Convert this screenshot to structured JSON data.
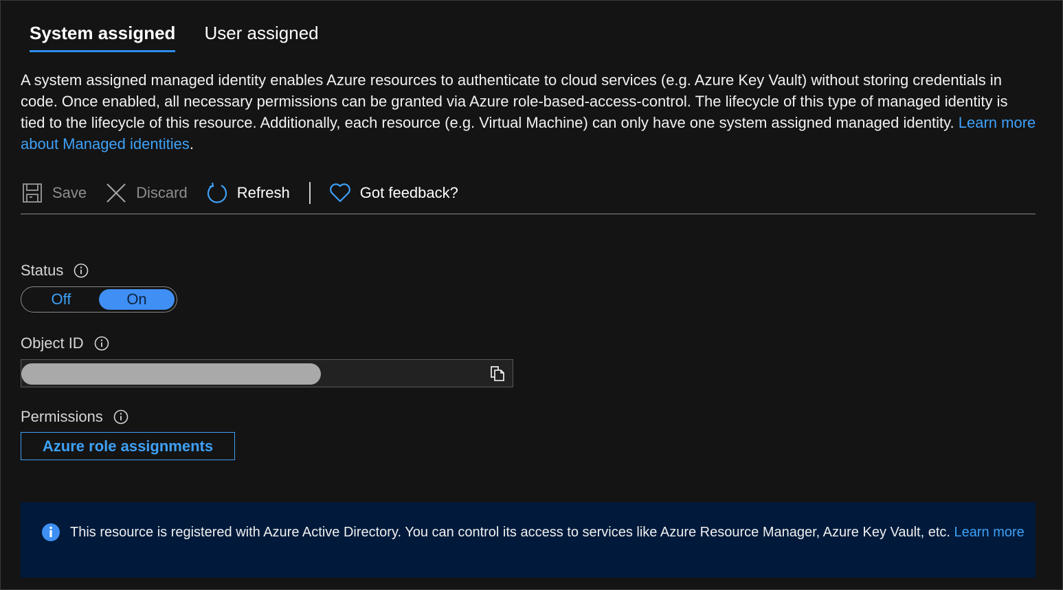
{
  "tabs": [
    {
      "label": "System assigned",
      "active": true
    },
    {
      "label": "User assigned",
      "active": false
    }
  ],
  "description": {
    "text": "A system assigned managed identity enables Azure resources to authenticate to cloud services (e.g. Azure Key Vault) without storing credentials in code. Once enabled, all necessary permissions can be granted via Azure role-based-access-control. The lifecycle of this type of managed identity is tied to the lifecycle of this resource. Additionally, each resource (e.g. Virtual Machine) can only have one system assigned managed identity. ",
    "link_text": "Learn more about Managed identities",
    "trailing": "."
  },
  "toolbar": {
    "save_label": "Save",
    "discard_label": "Discard",
    "refresh_label": "Refresh",
    "feedback_label": "Got feedback?"
  },
  "status": {
    "label": "Status",
    "off_label": "Off",
    "on_label": "On",
    "value": "On"
  },
  "object_id": {
    "label": "Object ID"
  },
  "permissions": {
    "label": "Permissions",
    "button_label": "Azure role assignments"
  },
  "banner": {
    "text": "This resource is registered with Azure Active Directory. You can control its access to services like Azure Resource Manager, Azure Key Vault, etc. ",
    "link_text": "Learn more"
  },
  "colors": {
    "background": "#141414",
    "accent": "#3ea1f7",
    "toggle_on": "#3f8ff5",
    "banner_bg": "#011a3b"
  },
  "icons": {
    "save": "save-icon",
    "discard": "discard-x-icon",
    "refresh": "refresh-icon",
    "feedback": "heart-icon",
    "info": "info-icon",
    "copy": "copy-icon"
  }
}
